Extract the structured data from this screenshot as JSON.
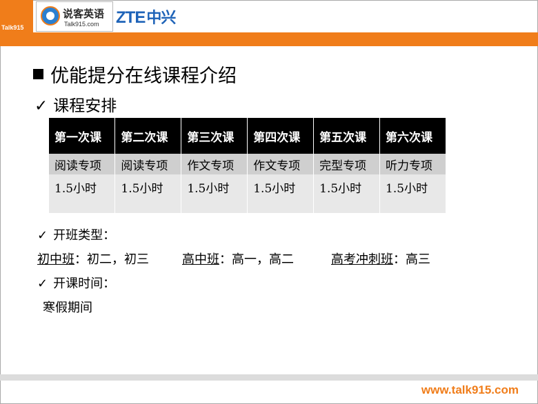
{
  "header": {
    "badge_text": "Talk915",
    "logo_name": "说客英语",
    "logo_url": "Talk915.com",
    "partner_latin": "ZTE",
    "partner_cn": "中兴",
    "brand_color": "#f07d1a",
    "partner_color": "#1e63b8"
  },
  "title": "优能提分在线课程介绍",
  "subtitle": "课程安排",
  "check_glyph": "✓",
  "schedule": {
    "headers": [
      "第一次课",
      "第二次课",
      "第三次课",
      "第四次课",
      "第五次课",
      "第六次课"
    ],
    "topics": [
      "阅读专项",
      "阅读专项",
      "作文专项",
      "作文专项",
      "完型专项",
      "听力专项"
    ],
    "durations": [
      "1.5小时",
      "1.5小时",
      "1.5小时",
      "1.5小时",
      "1.5小时",
      "1.5小时"
    ]
  },
  "class_types": {
    "heading": "开班类型：",
    "items": [
      {
        "name": "初中班",
        "grades": "：初二，初三"
      },
      {
        "name": "高中班",
        "grades": "：高一，高二"
      },
      {
        "name": "高考冲刺班",
        "grades": "：高三"
      }
    ]
  },
  "schedule_time": {
    "heading": "开课时间：",
    "value": "寒假期间"
  },
  "footer": {
    "website": "www.talk915.com"
  }
}
